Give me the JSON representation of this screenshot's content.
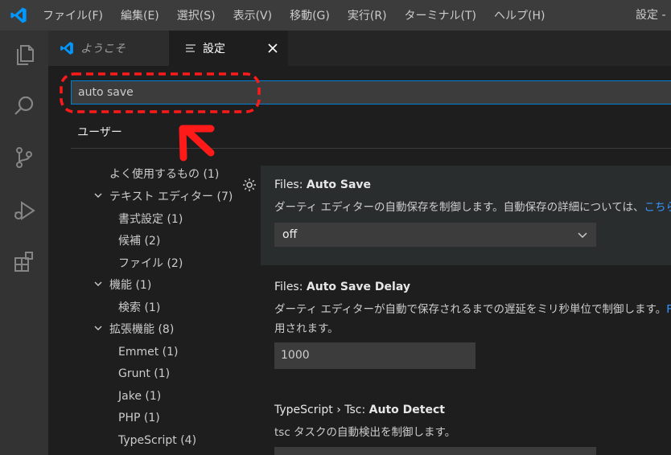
{
  "menubar": {
    "items": [
      "ファイル(F)",
      "編集(E)",
      "選択(S)",
      "表示(V)",
      "移動(G)",
      "実行(R)",
      "ターミナル(T)",
      "ヘルプ(H)"
    ],
    "window_title": "設定 -"
  },
  "tabs": [
    {
      "label": "ようこそ",
      "icon": "vscode-logo-icon",
      "active": false
    },
    {
      "label": "設定",
      "icon": "settings-list-icon",
      "active": true
    }
  ],
  "search": {
    "value": "auto save"
  },
  "scope": {
    "user_tab": "ユーザー"
  },
  "tree": [
    {
      "label": "よく使用するもの (1)",
      "level": 0,
      "expandable": false
    },
    {
      "label": "テキスト エディター (7)",
      "level": 0,
      "expandable": true
    },
    {
      "label": "書式設定 (1)",
      "level": 1
    },
    {
      "label": "候補 (2)",
      "level": 1
    },
    {
      "label": "ファイル (2)",
      "level": 1
    },
    {
      "label": "機能 (1)",
      "level": 0,
      "expandable": true
    },
    {
      "label": "検索 (1)",
      "level": 1
    },
    {
      "label": "拡張機能 (8)",
      "level": 0,
      "expandable": true
    },
    {
      "label": "Emmet (1)",
      "level": 1
    },
    {
      "label": "Grunt (1)",
      "level": 1
    },
    {
      "label": "Jake (1)",
      "level": 1
    },
    {
      "label": "PHP (1)",
      "level": 1
    },
    {
      "label": "TypeScript (4)",
      "level": 1
    }
  ],
  "settings": [
    {
      "category": "Files: ",
      "name": "Auto Save",
      "description": "ダーティ エディターの自動保存を制御します。自動保存の詳細については、",
      "link": "こちら",
      "control": "select",
      "value": "off"
    },
    {
      "category": "Files: ",
      "name": "Auto Save Delay",
      "description_line1": "ダーティ エディターが自動で保存されるまでの遅延をミリ秒単位で制御します。",
      "link": "Fi",
      "description_line2": "用されます。",
      "control": "number",
      "value": "1000"
    },
    {
      "category": "TypeScript › Tsc: ",
      "name": "Auto Detect",
      "description": "tsc タスクの自動検出を制御します。",
      "control": "select"
    }
  ],
  "colors": {
    "accent": "#007fd4",
    "annotation": "#ff1a1a",
    "link": "#3794ff"
  }
}
